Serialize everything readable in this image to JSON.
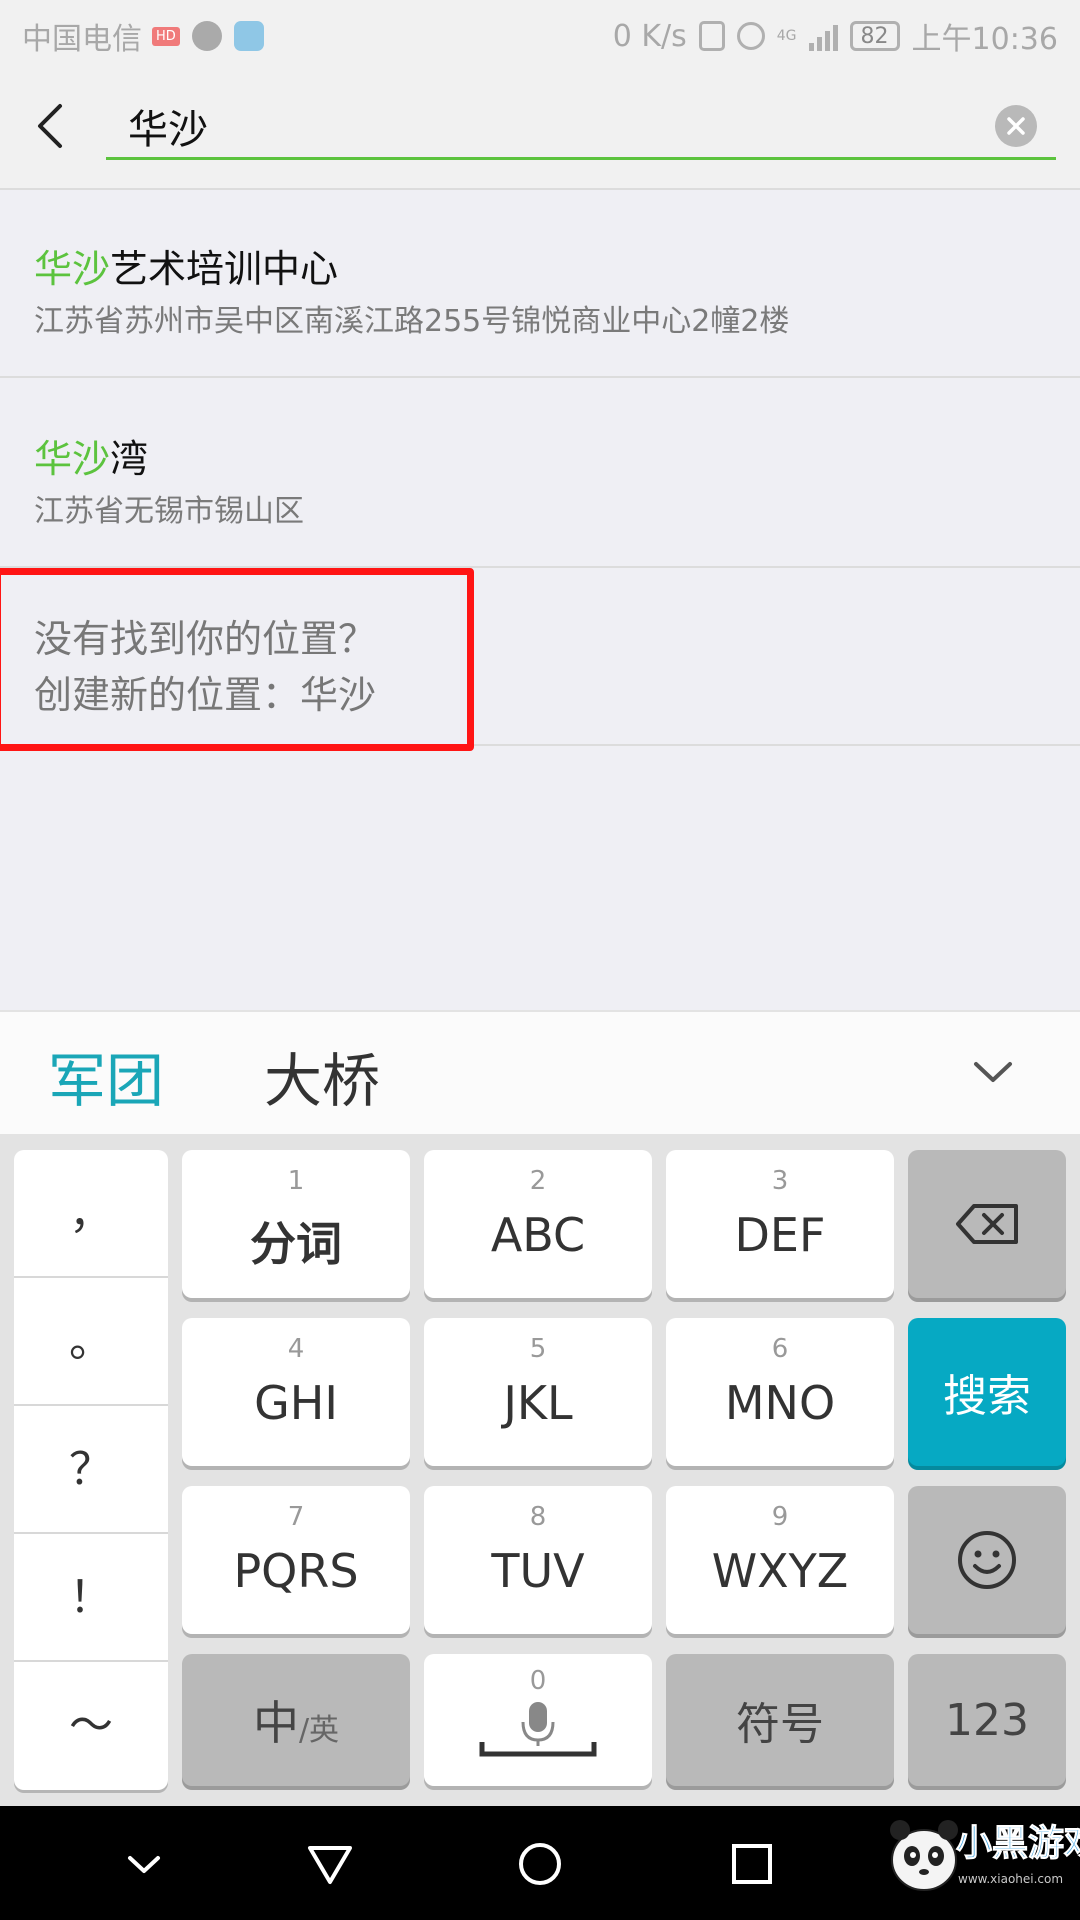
{
  "status_bar": {
    "carrier": "中国电信",
    "hd_badge": "HD",
    "net_speed": "0 K/s",
    "network": "4G",
    "battery": "82",
    "time": "上午10:36"
  },
  "search": {
    "query": "华沙"
  },
  "results": [
    {
      "title_highlight": "华沙",
      "title_rest": "艺术培训中心",
      "address": "江苏省苏州市吴中区南溪江路255号锦悦商业中心2幢2楼"
    },
    {
      "title_highlight": "华沙",
      "title_rest": "湾",
      "address": "江苏省无锡市锡山区"
    }
  ],
  "create_location": {
    "line1": "没有找到你的位置？",
    "line2": "创建新的位置：华沙"
  },
  "ime": {
    "candidates": [
      "军团",
      "大桥"
    ],
    "punctuation": [
      "，",
      "。",
      "？",
      "！",
      "～"
    ],
    "keys": [
      {
        "num": "1",
        "label": "分词"
      },
      {
        "num": "2",
        "label": "ABC"
      },
      {
        "num": "3",
        "label": "DEF"
      },
      {
        "num": "4",
        "label": "GHI"
      },
      {
        "num": "5",
        "label": "JKL"
      },
      {
        "num": "6",
        "label": "MNO"
      },
      {
        "num": "7",
        "label": "PQRS"
      },
      {
        "num": "8",
        "label": "TUV"
      },
      {
        "num": "9",
        "label": "WXYZ"
      }
    ],
    "search_key": "搜索",
    "lang_key_main": "中",
    "lang_key_sub": "/英",
    "space_num": "0",
    "symbols_key": "符号",
    "numbers_key": "123",
    "accent_color": "#06a9c3"
  },
  "highlight_color": "#5cc33e",
  "watermark": {
    "text": "小黑游戏",
    "url": "www.xiaohei.com"
  }
}
